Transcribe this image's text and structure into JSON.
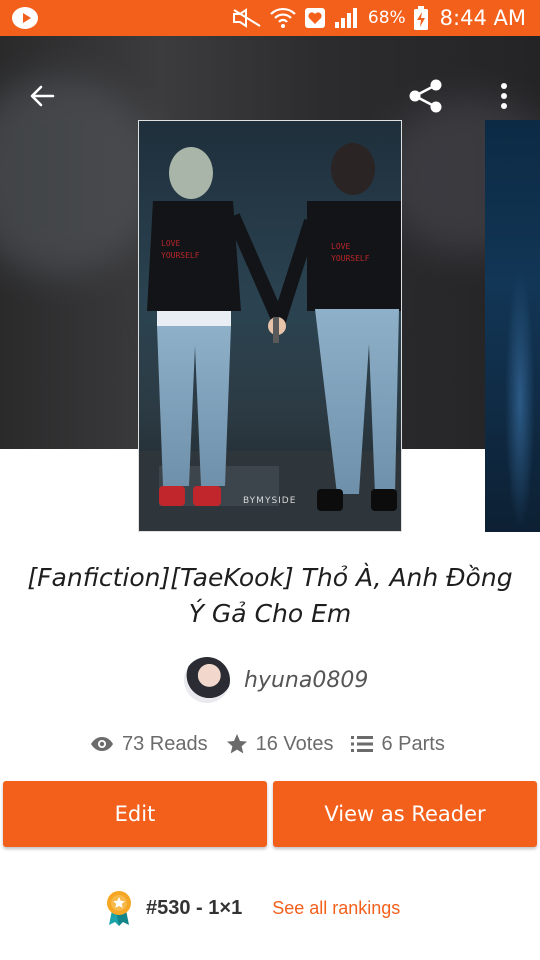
{
  "status_bar": {
    "battery_percent": "68%",
    "time": "8:44 AM",
    "icons": [
      "video-notification-icon",
      "mute-icon",
      "wifi-icon",
      "heart-notification-icon",
      "signal-icon",
      "battery-charging-icon"
    ]
  },
  "header": {
    "back_icon": "arrow-left-icon",
    "share_icon": "share-icon",
    "more_icon": "more-vertical-icon",
    "cover_caption": "BYMYSIDE"
  },
  "story": {
    "title": "[Fanfiction][TaeKook] Thỏ À, Anh Đồng Ý Gả Cho Em",
    "author": "hyuna0809",
    "stats": {
      "reads": "73 Reads",
      "votes": "16 Votes",
      "parts": "6 Parts"
    }
  },
  "actions": {
    "edit_label": "Edit",
    "reader_label": "View as Reader"
  },
  "ranking": {
    "text": "#530 - 1×1",
    "link": "See all rankings"
  },
  "colors": {
    "accent": "#f2601c",
    "text_dark": "#1e1e1e",
    "text_muted": "#6b6b6b"
  }
}
